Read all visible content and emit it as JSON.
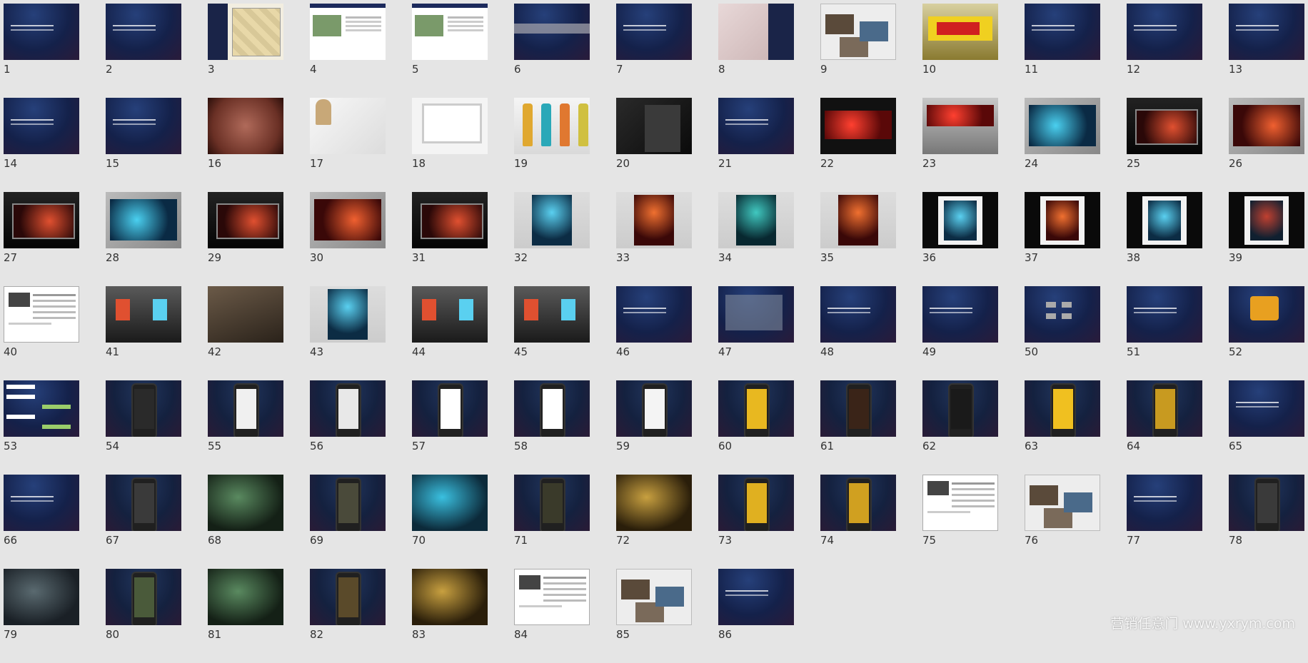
{
  "slides": [
    {
      "n": "1",
      "kind": "t-text"
    },
    {
      "n": "2",
      "kind": "t-text"
    },
    {
      "n": "3",
      "kind": "t-floor"
    },
    {
      "n": "4",
      "kind": "t-web"
    },
    {
      "n": "5",
      "kind": "t-web"
    },
    {
      "n": "6",
      "kind": "t-band"
    },
    {
      "n": "7",
      "kind": "t-text"
    },
    {
      "n": "8",
      "kind": "t-map"
    },
    {
      "n": "9",
      "kind": "t-collage"
    },
    {
      "n": "10",
      "kind": "t-signboard"
    },
    {
      "n": "11",
      "kind": "t-text"
    },
    {
      "n": "12",
      "kind": "t-text"
    },
    {
      "n": "13",
      "kind": "t-text"
    },
    {
      "n": "14",
      "kind": "t-text"
    },
    {
      "n": "15",
      "kind": "t-text"
    },
    {
      "n": "16",
      "kind": "t-leather"
    },
    {
      "n": "17",
      "kind": "t-stamp"
    },
    {
      "n": "18",
      "kind": "t-monitor"
    },
    {
      "n": "19",
      "kind": "t-bottles"
    },
    {
      "n": "20",
      "kind": "t-suit"
    },
    {
      "n": "21",
      "kind": "t-text"
    },
    {
      "n": "22",
      "kind": "t-billboard"
    },
    {
      "n": "23",
      "kind": "t-billboard road"
    },
    {
      "n": "24",
      "kind": "t-wide"
    },
    {
      "n": "25",
      "kind": "t-busstop"
    },
    {
      "n": "26",
      "kind": "t-wide red"
    },
    {
      "n": "27",
      "kind": "t-busstop"
    },
    {
      "n": "28",
      "kind": "t-wide"
    },
    {
      "n": "29",
      "kind": "t-busstop"
    },
    {
      "n": "30",
      "kind": "t-wide red"
    },
    {
      "n": "31",
      "kind": "t-busstop"
    },
    {
      "n": "32",
      "kind": "t-poster"
    },
    {
      "n": "33",
      "kind": "t-poster red"
    },
    {
      "n": "34",
      "kind": "t-poster teal"
    },
    {
      "n": "35",
      "kind": "t-poster red"
    },
    {
      "n": "36",
      "kind": "t-blackframe"
    },
    {
      "n": "37",
      "kind": "t-blackframe red"
    },
    {
      "n": "38",
      "kind": "t-blackframe"
    },
    {
      "n": "39",
      "kind": "t-blackframe mix"
    },
    {
      "n": "40",
      "kind": "t-doc"
    },
    {
      "n": "41",
      "kind": "t-subway"
    },
    {
      "n": "42",
      "kind": "t-photo"
    },
    {
      "n": "43",
      "kind": "t-poster"
    },
    {
      "n": "44",
      "kind": "t-subway"
    },
    {
      "n": "45",
      "kind": "t-subway"
    },
    {
      "n": "46",
      "kind": "t-text"
    },
    {
      "n": "47",
      "kind": "t-chart"
    },
    {
      "n": "48",
      "kind": "t-text"
    },
    {
      "n": "49",
      "kind": "t-text"
    },
    {
      "n": "50",
      "kind": "t-tags"
    },
    {
      "n": "51",
      "kind": "t-text"
    },
    {
      "n": "52",
      "kind": "t-slogan"
    },
    {
      "n": "53",
      "kind": "t-chat"
    },
    {
      "n": "54",
      "kind": "t-phone",
      "screen": "#2a2a2a"
    },
    {
      "n": "55",
      "kind": "t-phone",
      "screen": "#f0f0f0"
    },
    {
      "n": "56",
      "kind": "t-phone",
      "screen": "#e8e8e8"
    },
    {
      "n": "57",
      "kind": "t-phone",
      "screen": "#ffffff"
    },
    {
      "n": "58",
      "kind": "t-phone",
      "screen": "#ffffff"
    },
    {
      "n": "59",
      "kind": "t-phone",
      "screen": "#f4f4f4"
    },
    {
      "n": "60",
      "kind": "t-phone",
      "screen": "#e8b820"
    },
    {
      "n": "61",
      "kind": "t-phone",
      "screen": "#3a2418"
    },
    {
      "n": "62",
      "kind": "t-phone",
      "screen": "#1a1a1a"
    },
    {
      "n": "63",
      "kind": "t-phone",
      "screen": "#f0c020"
    },
    {
      "n": "64",
      "kind": "t-phone",
      "screen": "#c89a20"
    },
    {
      "n": "65",
      "kind": "t-text"
    },
    {
      "n": "66",
      "kind": "t-text"
    },
    {
      "n": "67",
      "kind": "t-phone",
      "screen": "#3a3a3a"
    },
    {
      "n": "68",
      "kind": "t-action green"
    },
    {
      "n": "69",
      "kind": "t-phone",
      "screen": "#4a4a3a"
    },
    {
      "n": "70",
      "kind": "t-action cyan"
    },
    {
      "n": "71",
      "kind": "t-phone",
      "screen": "#3a3a2a"
    },
    {
      "n": "72",
      "kind": "t-action gold"
    },
    {
      "n": "73",
      "kind": "t-phone",
      "screen": "#e0b020"
    },
    {
      "n": "74",
      "kind": "t-phone",
      "screen": "#d0a020"
    },
    {
      "n": "75",
      "kind": "t-doc"
    },
    {
      "n": "76",
      "kind": "t-collage"
    },
    {
      "n": "77",
      "kind": "t-text"
    },
    {
      "n": "78",
      "kind": "t-phone",
      "screen": "#3a3a3a"
    },
    {
      "n": "79",
      "kind": "t-action"
    },
    {
      "n": "80",
      "kind": "t-phone",
      "screen": "#4a5a3a"
    },
    {
      "n": "81",
      "kind": "t-action green"
    },
    {
      "n": "82",
      "kind": "t-phone",
      "screen": "#5a4a2a"
    },
    {
      "n": "83",
      "kind": "t-action gold"
    },
    {
      "n": "84",
      "kind": "t-doc"
    },
    {
      "n": "85",
      "kind": "t-collage"
    },
    {
      "n": "86",
      "kind": "t-text"
    }
  ],
  "watermark": "营销任意门 www.yxrym.com"
}
